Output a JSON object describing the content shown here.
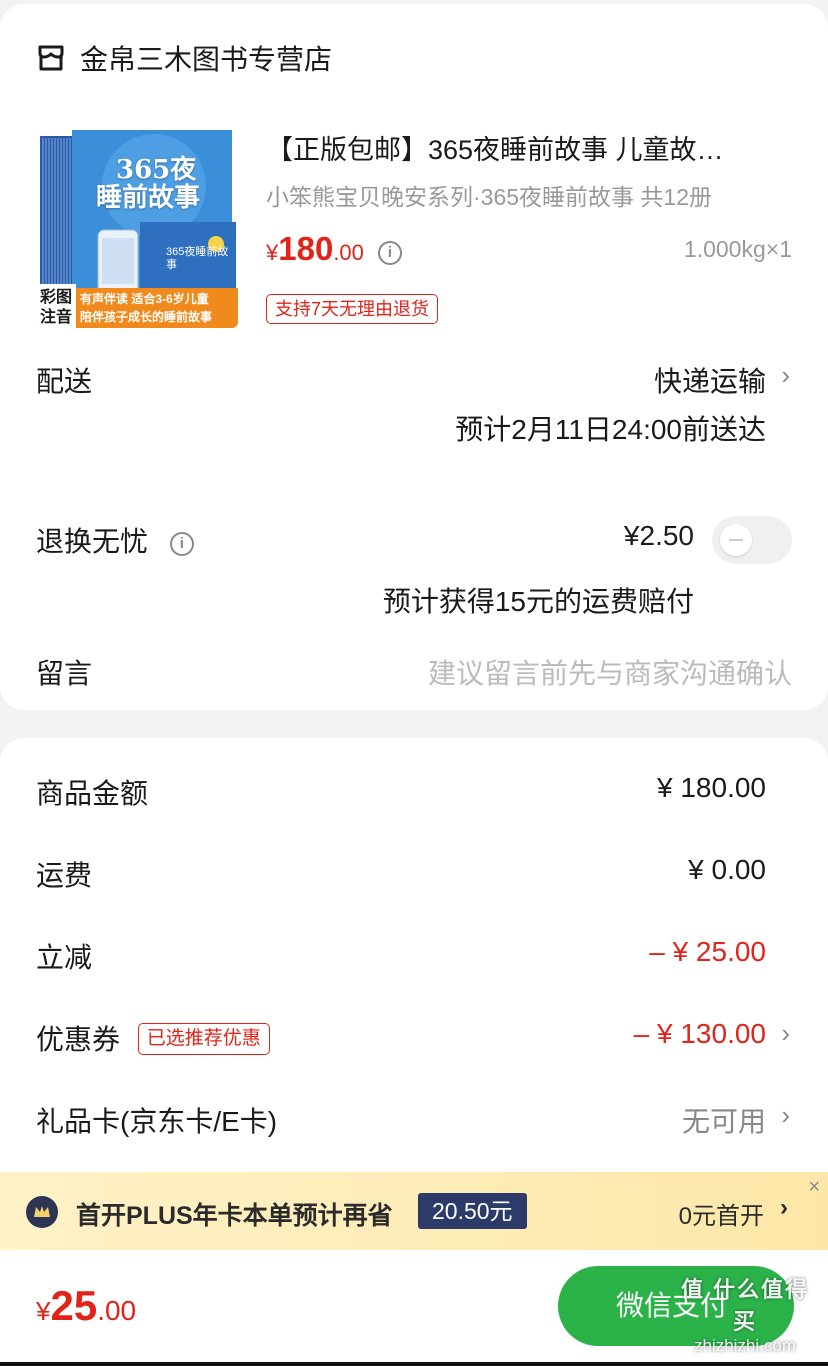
{
  "shop": {
    "name": "金帛三木图书专营店",
    "icon": "store-icon"
  },
  "product": {
    "title": "【正版包邮】365夜睡前故事 儿童故…",
    "subtitle": "小笨熊宝贝晚安系列·365夜睡前故事 共12册",
    "price": {
      "currency": "¥",
      "integer": "180",
      "decimal": ".00"
    },
    "quantity": "1.000kg×1",
    "return_tag": "支持7天无理由退货",
    "image": {
      "cover_title_1": "365夜",
      "cover_title_2": "睡前故事",
      "badge_1": "彩图",
      "badge_2": "注音",
      "banner_1": "有声伴读  适合3-6岁儿童",
      "banner_2": "陪伴孩子成长的睡前故事",
      "inner_title": "365夜睡前故事"
    }
  },
  "delivery": {
    "label": "配送",
    "method": "快递运输",
    "estimate": "预计2月11日24:00前送达"
  },
  "return_insurance": {
    "label": "退换无忧",
    "price": "¥2.50",
    "note": "预计获得15元的运费赔付",
    "enabled": false
  },
  "message": {
    "label": "留言",
    "placeholder": "建议留言前先与商家沟通确认"
  },
  "summary": {
    "goods_amount": {
      "label": "商品金额",
      "value": "¥ 180.00"
    },
    "shipping": {
      "label": "运费",
      "value": "¥ 0.00"
    },
    "instant_discount": {
      "label": "立减",
      "value": "– ¥ 25.00"
    },
    "coupon": {
      "label": "优惠券",
      "tag": "已选推荐优惠",
      "value": "– ¥ 130.00"
    },
    "gift_card": {
      "label": "礼品卡(京东卡/E卡)",
      "value": "无可用"
    }
  },
  "plus_banner": {
    "text": "首开PLUS年卡本单预计再省",
    "badge": "20.50元",
    "action": "0元首开",
    "close": "×"
  },
  "footer": {
    "total": {
      "currency": "¥",
      "integer": "25",
      "decimal": ".00"
    },
    "pay_button": "微信支付"
  },
  "watermark": {
    "main": "值 什么值得买",
    "sub": "zhizhizhi.com"
  },
  "colors": {
    "accent_red": "#e2231a",
    "pay_green": "#2bb34a",
    "plus_navy": "#2d3b6b",
    "plus_yellow": "#fde7a8"
  }
}
